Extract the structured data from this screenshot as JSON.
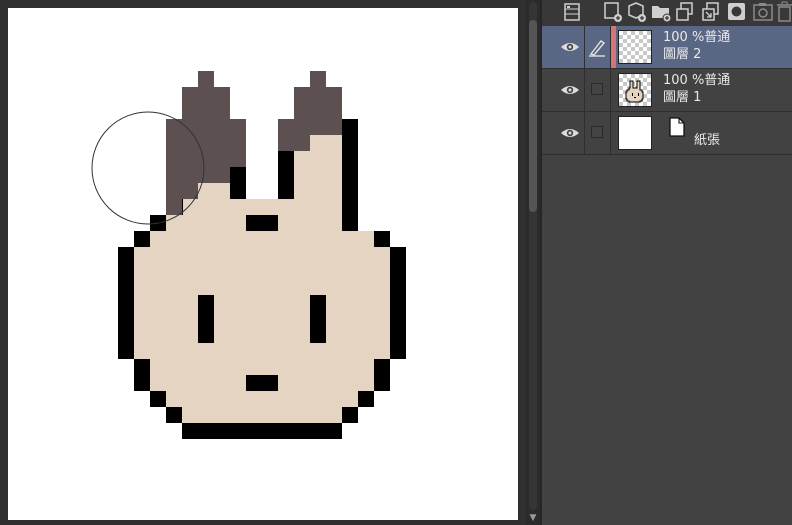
{
  "toolbar": {
    "icons": [
      "layer-properties-icon",
      "new-raster-layer-icon",
      "new-vector-layer-icon",
      "new-folder-icon",
      "copy-layer-icon",
      "merge-down-icon",
      "layer-mask-icon",
      "camera-icon",
      "delete-layer-icon"
    ]
  },
  "layers": [
    {
      "opacity_blend": "100 %普通",
      "name": "圖層 2",
      "selected": true,
      "visible": true,
      "editing": true,
      "thumbnail": "checker"
    },
    {
      "opacity_blend": "100 %普通",
      "name": "圖層 1",
      "selected": false,
      "visible": true,
      "editing": false,
      "thumbnail": "bunny"
    },
    {
      "name": "紙張",
      "selected": false,
      "visible": true,
      "editing": false,
      "thumbnail": "white",
      "paper": true
    }
  ],
  "colors": {
    "outline": "#000000",
    "bunny_fill": "#e6d4c3",
    "ear_brown": "#5d5051",
    "selected_layer": "#5a6784",
    "layer_color_strip": "#d9737a",
    "panel_bg": "#424242"
  },
  "canvas": {
    "brush_cursor": "circle-brush-cursor-icon"
  }
}
